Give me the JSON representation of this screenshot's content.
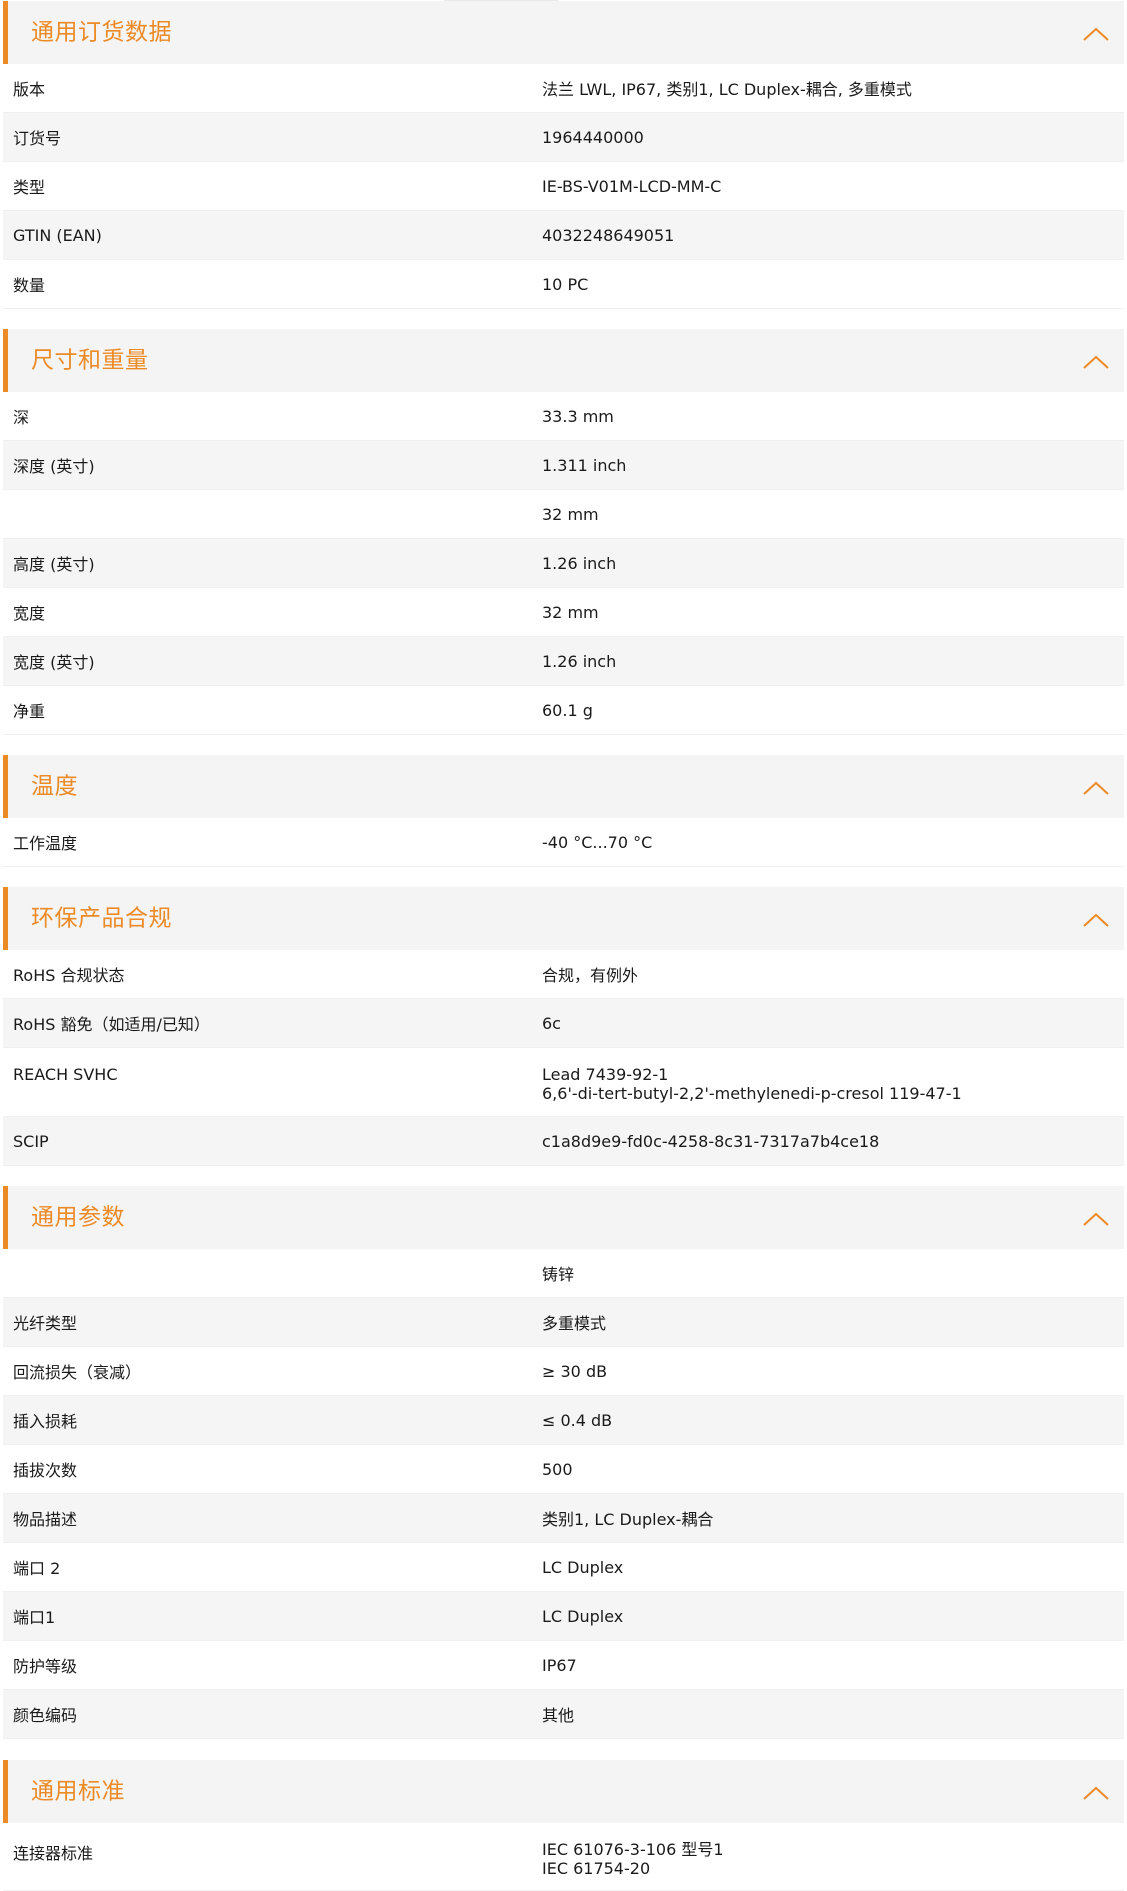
{
  "sections": [
    {
      "title": "通用订货数据",
      "rows": [
        {
          "label": "版本",
          "value": [
            "法兰 LWL, IP67, 类别1, LC Duplex-耦合, 多重模式"
          ]
        },
        {
          "label": "订货号",
          "value": [
            "1964440000"
          ]
        },
        {
          "label": "类型",
          "value": [
            "IE-BS-V01M-LCD-MM-C"
          ]
        },
        {
          "label": "GTIN (EAN)",
          "value": [
            "4032248649051"
          ]
        },
        {
          "label": "数量",
          "value": [
            "10  PC"
          ]
        }
      ]
    },
    {
      "title": "尺寸和重量",
      "rows": [
        {
          "label": "深",
          "value": [
            "33.3  mm"
          ]
        },
        {
          "label": "深度 (英寸)",
          "value": [
            "1.311  inch"
          ]
        },
        {
          "label": "",
          "value": [
            "32  mm"
          ]
        },
        {
          "label": "高度 (英寸)",
          "value": [
            "1.26  inch"
          ]
        },
        {
          "label": "宽度",
          "value": [
            "32  mm"
          ]
        },
        {
          "label": "宽度 (英寸)",
          "value": [
            "1.26  inch"
          ]
        },
        {
          "label": "净重",
          "value": [
            "60.1  g"
          ]
        }
      ]
    },
    {
      "title": "温度",
      "rows": [
        {
          "label": "工作温度",
          "value": [
            "-40 °C...70 °C"
          ]
        }
      ]
    },
    {
      "title": "环保产品合规",
      "rows": [
        {
          "label": "RoHS 合规状态",
          "value": [
            "合规，有例外"
          ]
        },
        {
          "label": "RoHS 豁免（如适用/已知）",
          "value": [
            "6c"
          ]
        },
        {
          "label": "REACH SVHC",
          "value": [
            "Lead 7439-92-1",
            "6,6'-di-tert-butyl-2,2'-methylenedi-p-cresol 119-47-1"
          ]
        },
        {
          "label": "SCIP",
          "value": [
            "c1a8d9e9-fd0c-4258-8c31-7317a7b4ce18"
          ]
        }
      ]
    },
    {
      "title": "通用参数",
      "rows": [
        {
          "label": "",
          "value": [
            "铸锌"
          ]
        },
        {
          "label": "光纤类型",
          "value": [
            "多重模式"
          ]
        },
        {
          "label": "回流损失（衰减）",
          "value": [
            "≥ 30 dB"
          ]
        },
        {
          "label": "插入损耗",
          "value": [
            "≤ 0.4 dB"
          ]
        },
        {
          "label": "插拔次数",
          "value": [
            "500"
          ]
        },
        {
          "label": "物品描述",
          "value": [
            "类别1, LC Duplex-耦合"
          ]
        },
        {
          "label": "端口 2",
          "value": [
            "LC Duplex"
          ]
        },
        {
          "label": "端口1",
          "value": [
            "LC Duplex"
          ]
        },
        {
          "label": "防护等级",
          "value": [
            "IP67"
          ]
        },
        {
          "label": "颜色编码",
          "value": [
            "其他"
          ]
        }
      ]
    },
    {
      "title": "通用标准",
      "rows": [
        {
          "label": "连接器标准",
          "value": [
            "IEC 61076-3-106 型号1",
            "IEC 61754-20"
          ]
        }
      ]
    }
  ],
  "colors": {
    "accent": "#ec8a26",
    "header_bg": "#f4f4f4",
    "row_alt_bg": "#f5f5f5"
  },
  "icons": {
    "collapse": "chevron-up-icon"
  }
}
